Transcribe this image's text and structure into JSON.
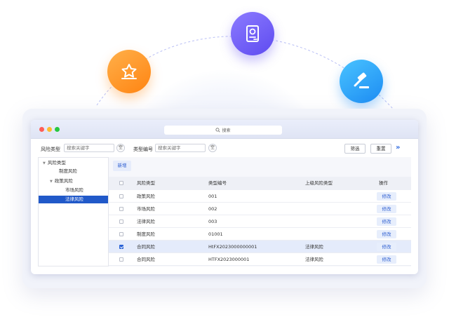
{
  "window": {
    "search_placeholder": "搜索"
  },
  "filters": {
    "risk_type_label": "风险类型",
    "risk_type_placeholder": "搜索关键字",
    "clear_label": "空",
    "type_code_label": "类型编号",
    "type_code_placeholder": "搜索关键字",
    "filter_button": "筛选",
    "reset_button": "重置",
    "expand_glyph": "»"
  },
  "tree": {
    "root": "风险类型",
    "items": [
      {
        "label": "制度风险",
        "selected": false
      },
      {
        "label": "政策风险",
        "selected": false
      },
      {
        "label": "市场风险",
        "selected": false
      },
      {
        "label": "法律风险",
        "selected": true
      }
    ]
  },
  "toolbar": {
    "add_button": "新增"
  },
  "table": {
    "columns": [
      "风险类型",
      "类型编号",
      "上级风险类型",
      "操作"
    ],
    "action_label": "修改",
    "rows": [
      {
        "type": "政策风险",
        "code": "001",
        "parent": "",
        "checked": false
      },
      {
        "type": "市场风险",
        "code": "002",
        "parent": "",
        "checked": false
      },
      {
        "type": "法律风险",
        "code": "003",
        "parent": "",
        "checked": false
      },
      {
        "type": "制度风险",
        "code": "01001",
        "parent": "",
        "checked": false
      },
      {
        "type": "合同风险",
        "code": "HtFX2023000000001",
        "parent": "法律风险",
        "checked": true
      },
      {
        "type": "合同风险",
        "code": "HTFX2023000001",
        "parent": "法律风险",
        "checked": false
      }
    ]
  },
  "decor": {
    "icons": [
      "star-badge-icon",
      "document-certificate-icon",
      "gavel-icon"
    ],
    "colors": {
      "orange": "#ff9a2e",
      "purple": "#6f5cf6",
      "blue": "#2e9cf6",
      "accent": "#2159c9"
    }
  }
}
